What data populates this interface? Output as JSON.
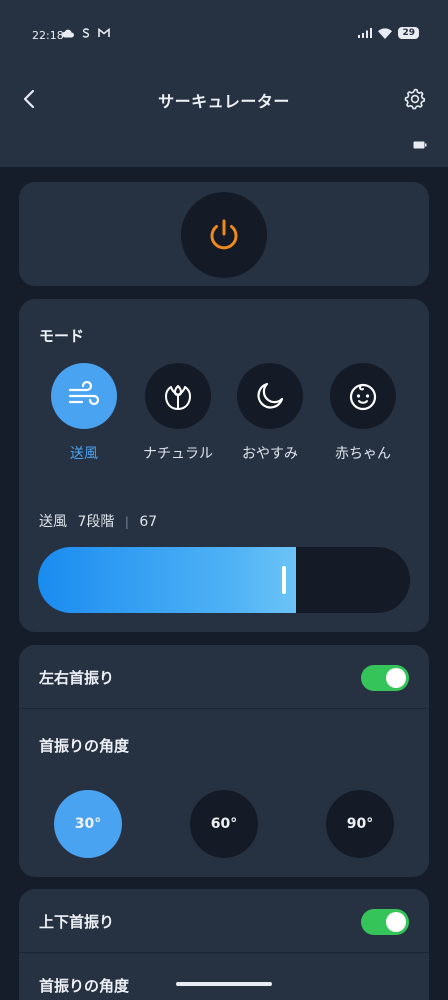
{
  "status_bar": {
    "time": "22:18",
    "left_icons": [
      "cloud-icon",
      "s-icon",
      "gmail-icon"
    ],
    "right_icons": [
      "signal-icon",
      "wifi-icon"
    ],
    "battery": "29"
  },
  "header": {
    "title": "サーキュレーター",
    "back_icon": "chevron-left-icon",
    "settings_icon": "gear-icon"
  },
  "power": {
    "icon": "power-icon",
    "color": "#f08a1c"
  },
  "mode": {
    "title": "モード",
    "items": [
      {
        "label": "送風",
        "icon": "wind-icon",
        "active": true
      },
      {
        "label": "ナチュラル",
        "icon": "leaf-icon",
        "active": false
      },
      {
        "label": "おやすみ",
        "icon": "moon-icon",
        "active": false
      },
      {
        "label": "赤ちゃん",
        "icon": "baby-icon",
        "active": false
      }
    ]
  },
  "speed": {
    "mode": "送風",
    "level": "7段階",
    "value": "67",
    "fill_fraction": 0.694
  },
  "horizontal_swing": {
    "label": "左右首振り",
    "enabled": true,
    "angle_title": "首振りの角度",
    "angles": [
      "30°",
      "60°",
      "90°"
    ],
    "selected": "30°"
  },
  "vertical_swing": {
    "label": "上下首振り",
    "enabled": true,
    "angle_title": "首振りの角度"
  },
  "colors": {
    "accent": "#4aa3f0",
    "toggle_on": "#35c45a",
    "card": "#263142",
    "background": "#151d2a"
  }
}
